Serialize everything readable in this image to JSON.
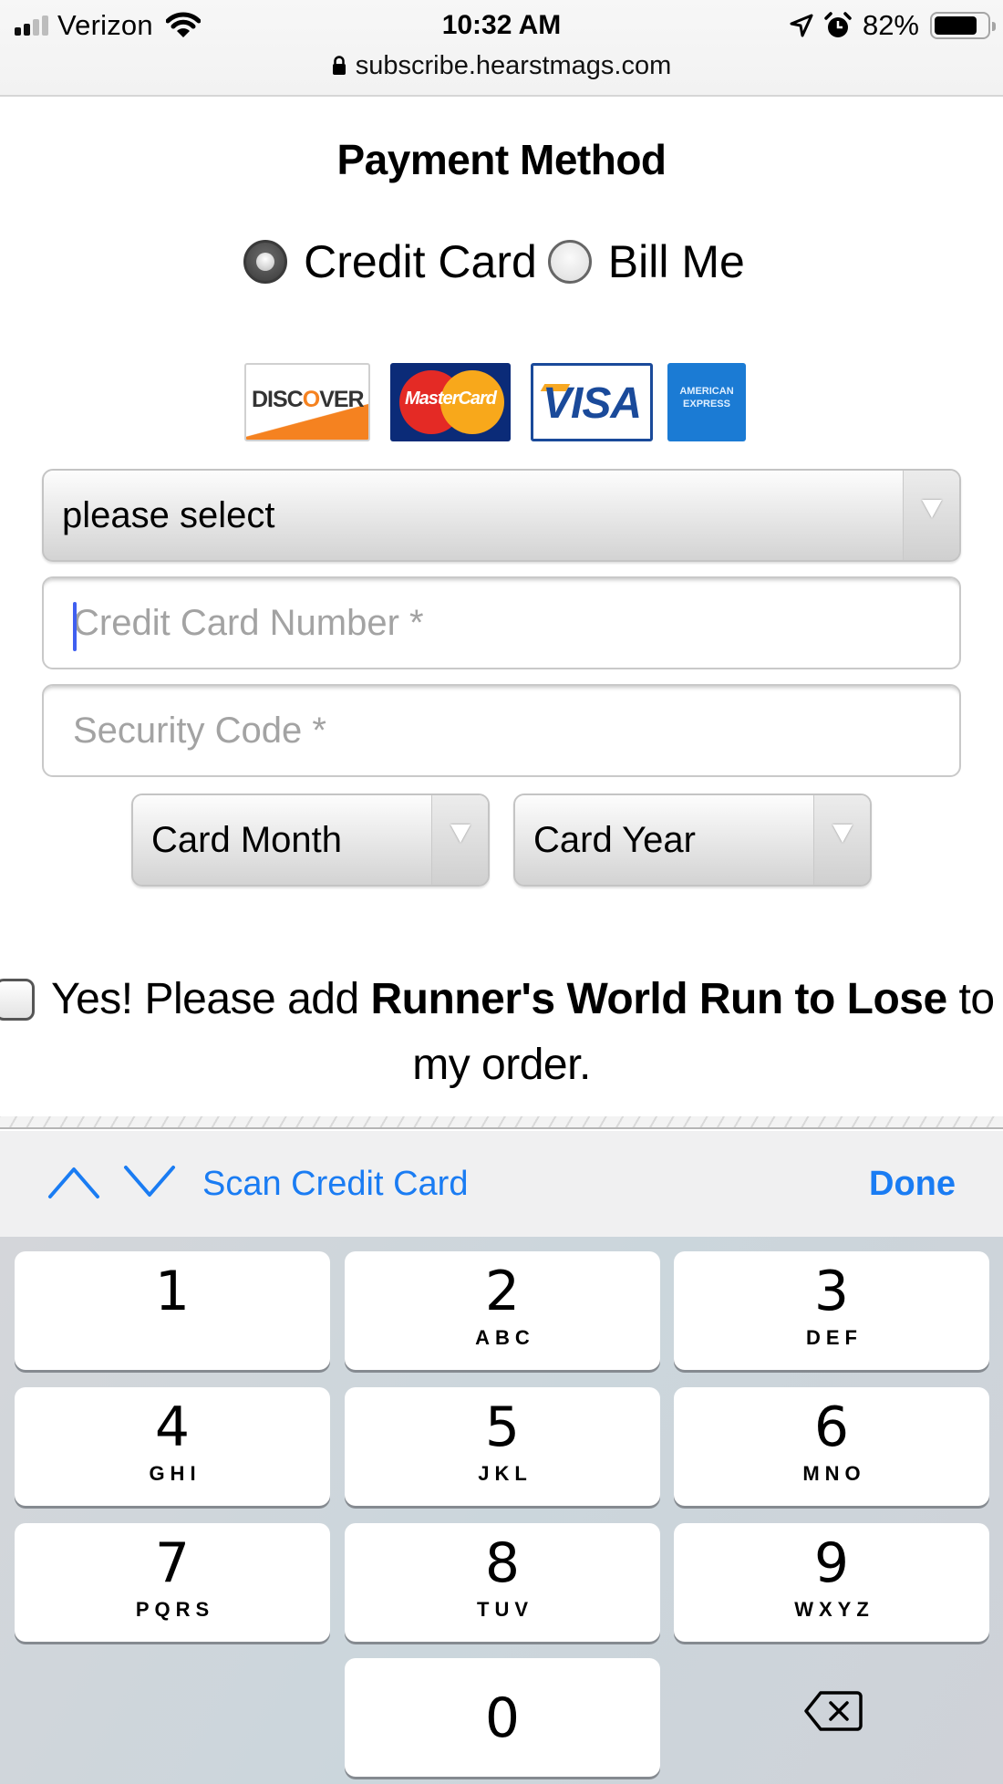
{
  "status_bar": {
    "carrier": "Verizon",
    "signal_bars_filled": 2,
    "signal_bars_total": 4,
    "time": "10:32 AM",
    "battery_percent": "82%",
    "battery_level": 0.82,
    "icons": [
      "signal-icon",
      "wifi-icon",
      "location-arrow-icon",
      "alarm-icon",
      "battery-icon"
    ]
  },
  "browser": {
    "url": "subscribe.hearstmags.com",
    "secure": true
  },
  "page": {
    "title": "Payment Method",
    "payment_options": [
      {
        "label": "Credit Card",
        "checked": true
      },
      {
        "label": "Bill Me",
        "checked": false
      }
    ],
    "card_logos": [
      "DISCOVER",
      "MasterCard",
      "VISA",
      "AMERICAN EXPRESS"
    ],
    "card_type_select": {
      "value": "please select"
    },
    "card_number": {
      "placeholder": "Credit Card Number *",
      "value": "",
      "focused": true
    },
    "security_code": {
      "placeholder": "Security Code *",
      "value": ""
    },
    "card_month_select": {
      "value": "Card Month"
    },
    "card_year_select": {
      "value": "Card Year"
    },
    "addon": {
      "checked": false,
      "prefix": "Yes! Please add ",
      "product": "Runner's World Run to Lose",
      "suffix": " to",
      "line2": "my order."
    }
  },
  "keyboard_toolbar": {
    "prev_icon": "chevron-up-icon",
    "next_icon": "chevron-down-icon",
    "scan_label": "Scan Credit Card",
    "done_label": "Done",
    "accent_color": "#1a7cf3"
  },
  "keypad": {
    "keys": [
      {
        "num": "1",
        "letters": ""
      },
      {
        "num": "2",
        "letters": "ABC"
      },
      {
        "num": "3",
        "letters": "DEF"
      },
      {
        "num": "4",
        "letters": "GHI"
      },
      {
        "num": "5",
        "letters": "JKL"
      },
      {
        "num": "6",
        "letters": "MNO"
      },
      {
        "num": "7",
        "letters": "PQRS"
      },
      {
        "num": "8",
        "letters": "TUV"
      },
      {
        "num": "9",
        "letters": "WXYZ"
      },
      {
        "num": "0",
        "letters": ""
      }
    ],
    "delete_icon": "backspace-icon"
  }
}
